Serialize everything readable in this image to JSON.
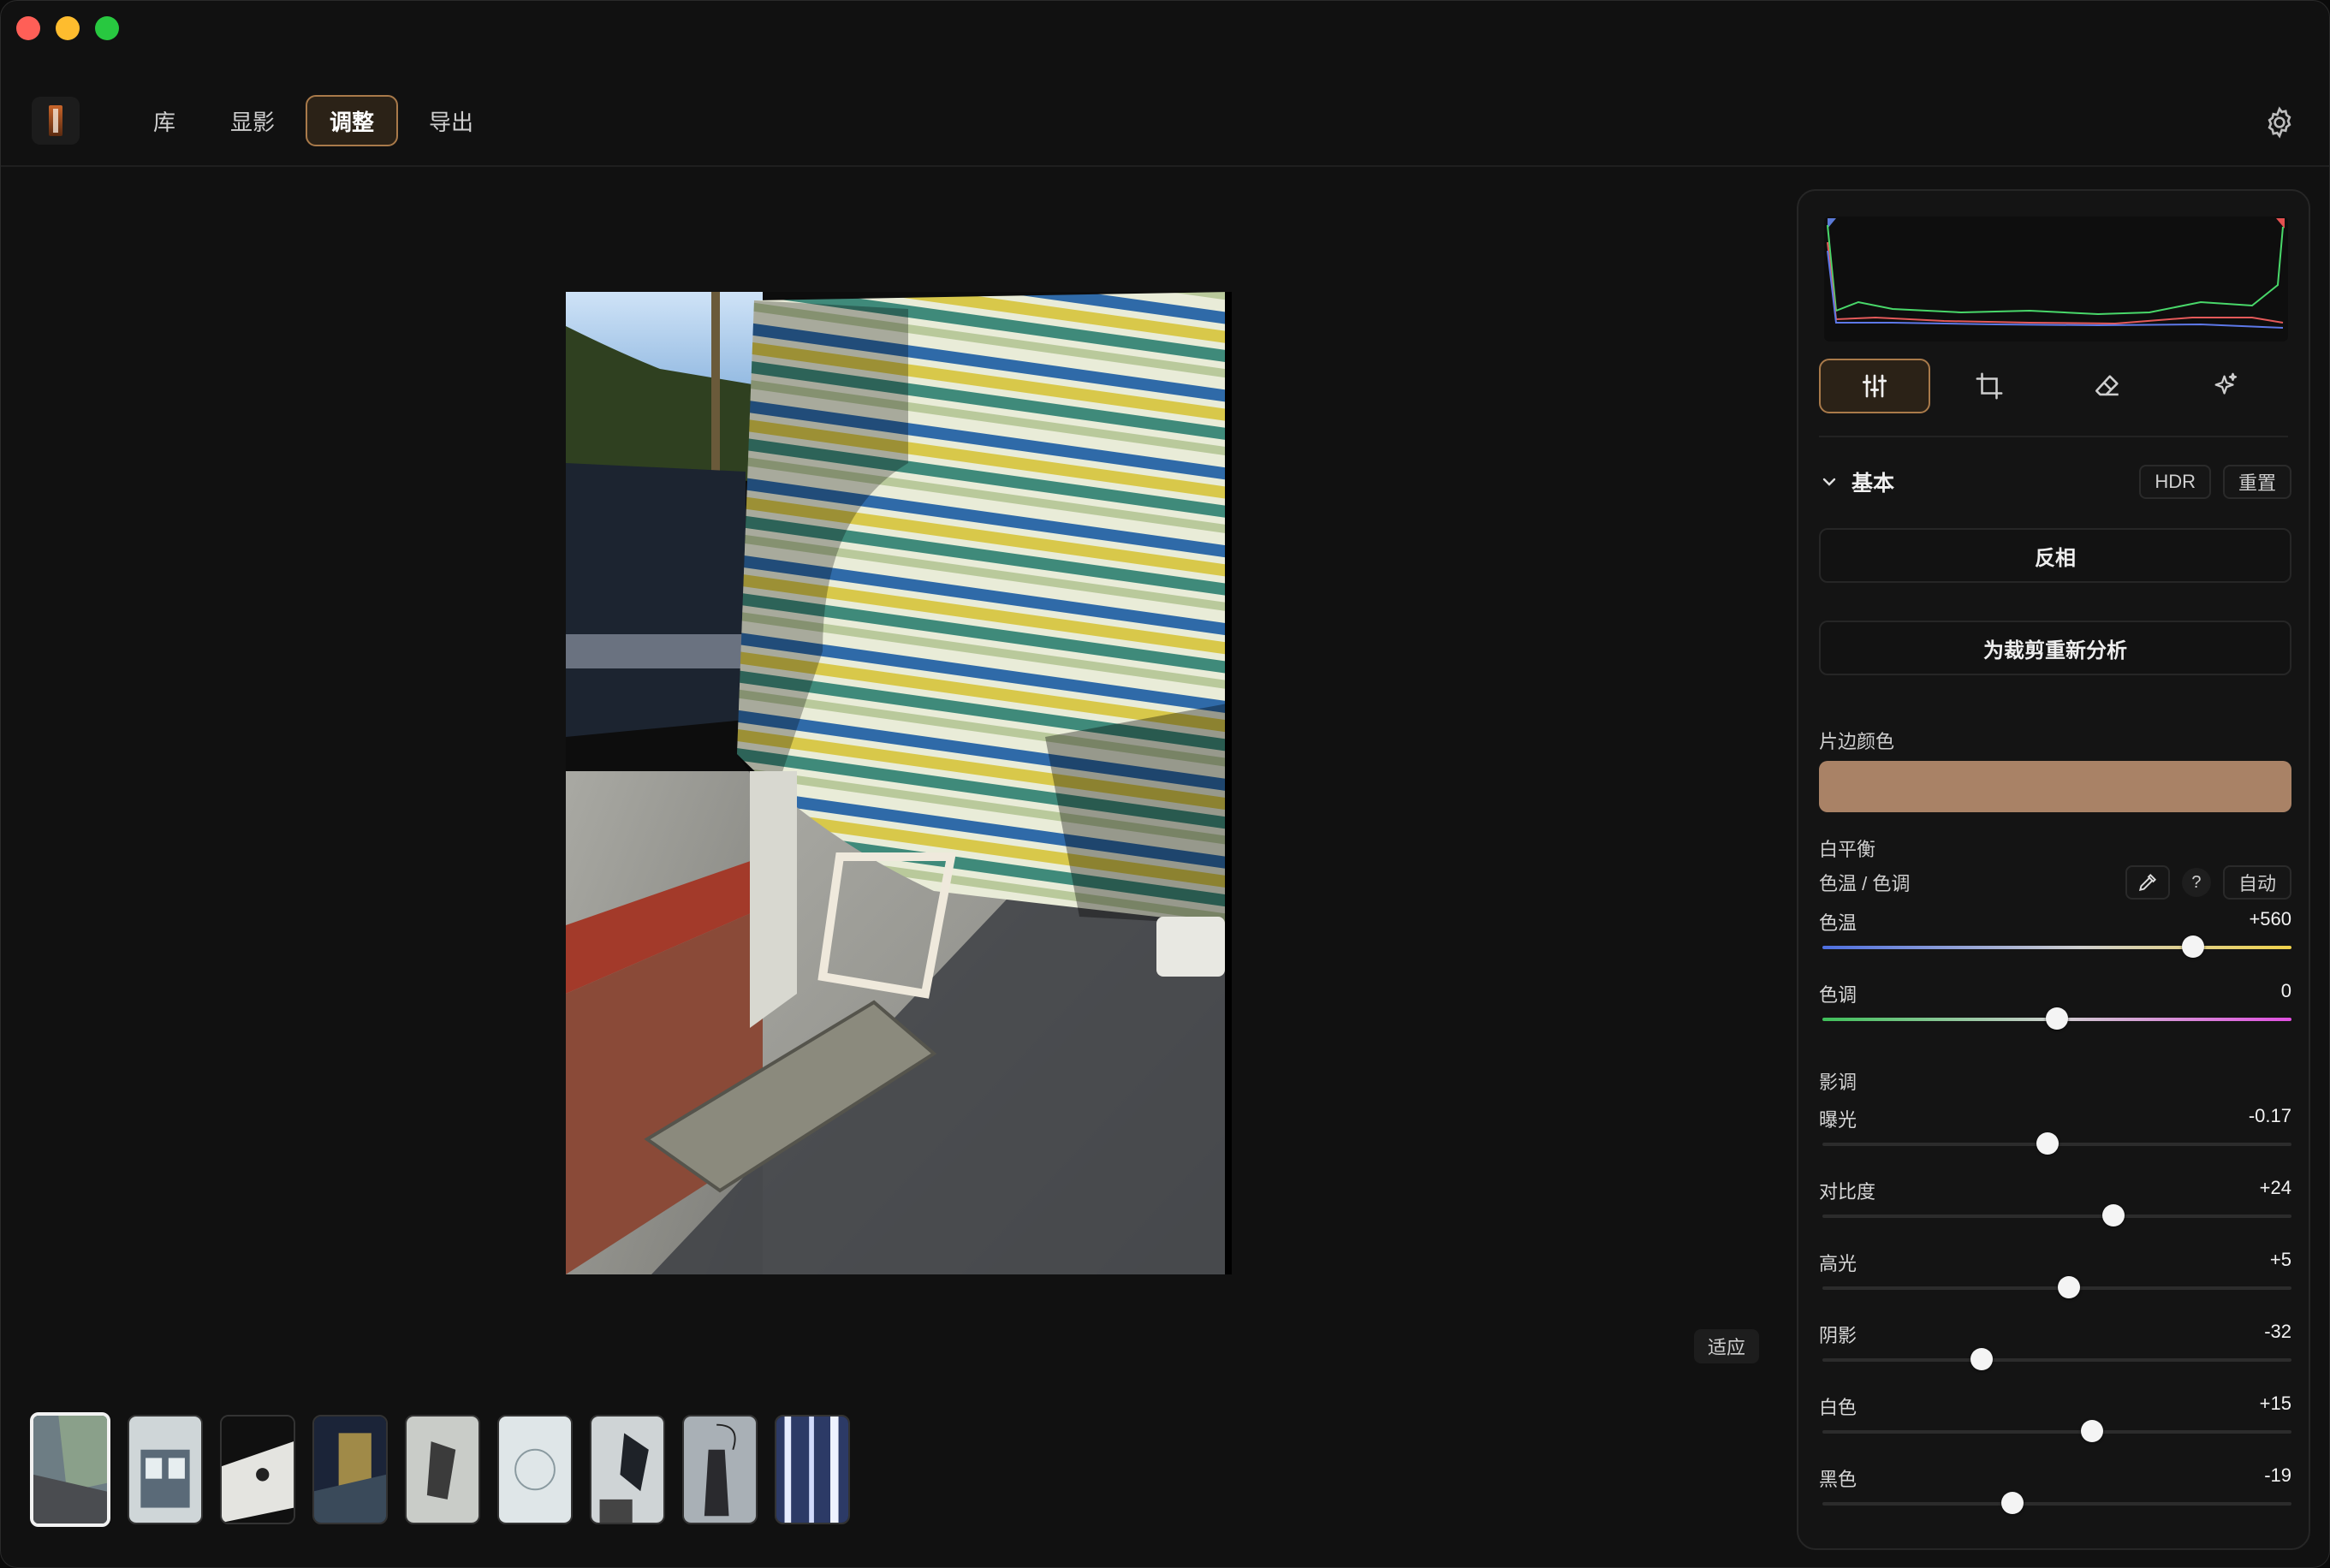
{
  "window": {
    "title": ""
  },
  "nav": {
    "tabs": [
      {
        "label": "库"
      },
      {
        "label": "显影"
      },
      {
        "label": "调整",
        "active": true
      },
      {
        "label": "导出"
      }
    ]
  },
  "canvas": {
    "fit_label": "适应"
  },
  "filmstrip": {
    "count": 9,
    "selected": 0
  },
  "panel": {
    "tools": [
      "sliders-icon",
      "crop-icon",
      "eraser-icon",
      "sparkle-icon"
    ],
    "section": {
      "title": "基本",
      "hdr_label": "HDR",
      "reset_label": "重置"
    },
    "invert_label": "反相",
    "reanalyze_label": "为裁剪重新分析",
    "film_border": {
      "label": "片边颜色",
      "color": "#a98266"
    },
    "white_balance": {
      "label": "白平衡",
      "temp_tint_label": "色温 / 色调",
      "help_label": "?",
      "auto_label": "自动",
      "sliders": [
        {
          "name": "色温",
          "value": "+560",
          "position": 0.79,
          "gradient": "temp"
        },
        {
          "name": "色调",
          "value": "0",
          "position": 0.5,
          "gradient": "tint"
        }
      ]
    },
    "tone": {
      "label": "影调",
      "sliders": [
        {
          "name": "曝光",
          "value": "-0.17",
          "position": 0.48
        },
        {
          "name": "对比度",
          "value": "+24",
          "position": 0.62
        },
        {
          "name": "高光",
          "value": "+5",
          "position": 0.525
        },
        {
          "name": "阴影",
          "value": "-32",
          "position": 0.34
        },
        {
          "name": "白色",
          "value": "+15",
          "position": 0.575
        },
        {
          "name": "黑色",
          "value": "-19",
          "position": 0.405
        }
      ]
    }
  }
}
